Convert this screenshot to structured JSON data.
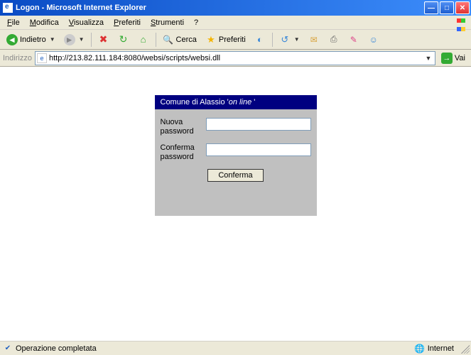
{
  "window": {
    "title": "Logon - Microsoft Internet Explorer"
  },
  "menu": {
    "file": "File",
    "file_u": "F",
    "modifica": "Modifica",
    "modifica_u": "M",
    "visualizza": "Visualizza",
    "visualizza_u": "V",
    "preferiti": "Preferiti",
    "preferiti_u": "P",
    "strumenti": "Strumenti",
    "strumenti_u": "S",
    "help": "?"
  },
  "toolbar": {
    "back": "Indietro",
    "search": "Cerca",
    "favorites": "Preferiti"
  },
  "address": {
    "label": "Indirizzo",
    "url": "http://213.82.111.184:8080/websi/scripts/websi.dll",
    "go": "Vai"
  },
  "panel": {
    "title_prefix": "Comune di Alassio '",
    "title_em": "on line",
    "title_suffix": " '",
    "new_password_label": "Nuova password",
    "confirm_password_label": "Conferma password",
    "submit": "Conferma",
    "new_password_value": "",
    "confirm_password_value": ""
  },
  "status": {
    "text": "Operazione completata",
    "zone": "Internet"
  }
}
